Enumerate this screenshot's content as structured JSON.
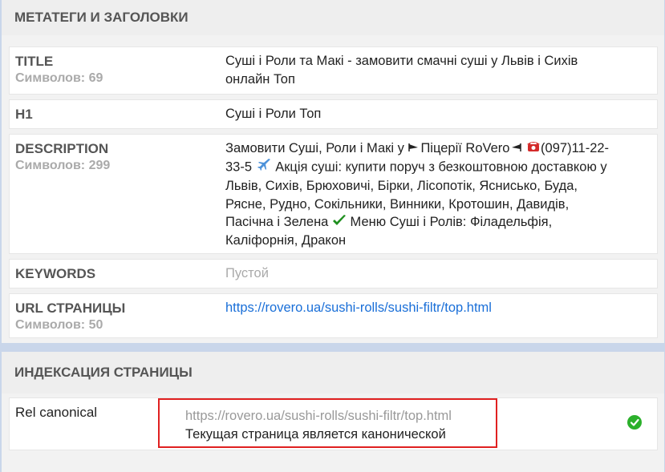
{
  "meta_section": {
    "title": "МЕТАТЕГИ И ЗАГОЛОВКИ",
    "rows": {
      "title": {
        "label": "TITLE",
        "sub": "Символов: 69",
        "value": "Суші і Роли та Макі - замовити смачні суші у Львів і Сихів онлайн Топ"
      },
      "h1": {
        "label": "H1",
        "value": "Суші і Роли Топ"
      },
      "description": {
        "label": "DESCRIPTION",
        "sub": "Символов: 299",
        "part1": "Замовити Суші, Роли і Макі у ",
        "part2": "Піцерії RoVero",
        "part3": "(097)11-22-33-5 ",
        "part4": " Акція суші: купити поруч з безкоштовною доставкою у Львів, Сихів, Брюховичі, Бірки, Лісопотік, Яснисько, Буда, Рясне, Рудно, Сокільники, Винники, Кротошин, Давидів, Пасічна і Зелена ",
        "part5": " Меню Суші і Ролів: Філадельфія, Каліфорнія, Дракон"
      },
      "keywords": {
        "label": "KEYWORDS",
        "value": "Пустой"
      },
      "url": {
        "label": "URL СТРАНИЦЫ",
        "sub": "Символов: 50",
        "value": "https://rovero.ua/sushi-rolls/sushi-filtr/top.html"
      }
    }
  },
  "index_section": {
    "title": "ИНДЕКСАЦИЯ СТРАНИЦЫ",
    "rel_canonical": {
      "label": "Rel canonical",
      "url": "https://rovero.ua/sushi-rolls/sushi-filtr/top.html",
      "note": "Текущая страница является канонической",
      "status_icon": "check-circle-icon"
    }
  },
  "colors": {
    "link": "#1a6fd8",
    "ok": "#2bb02b",
    "highlight": "#e02020"
  }
}
